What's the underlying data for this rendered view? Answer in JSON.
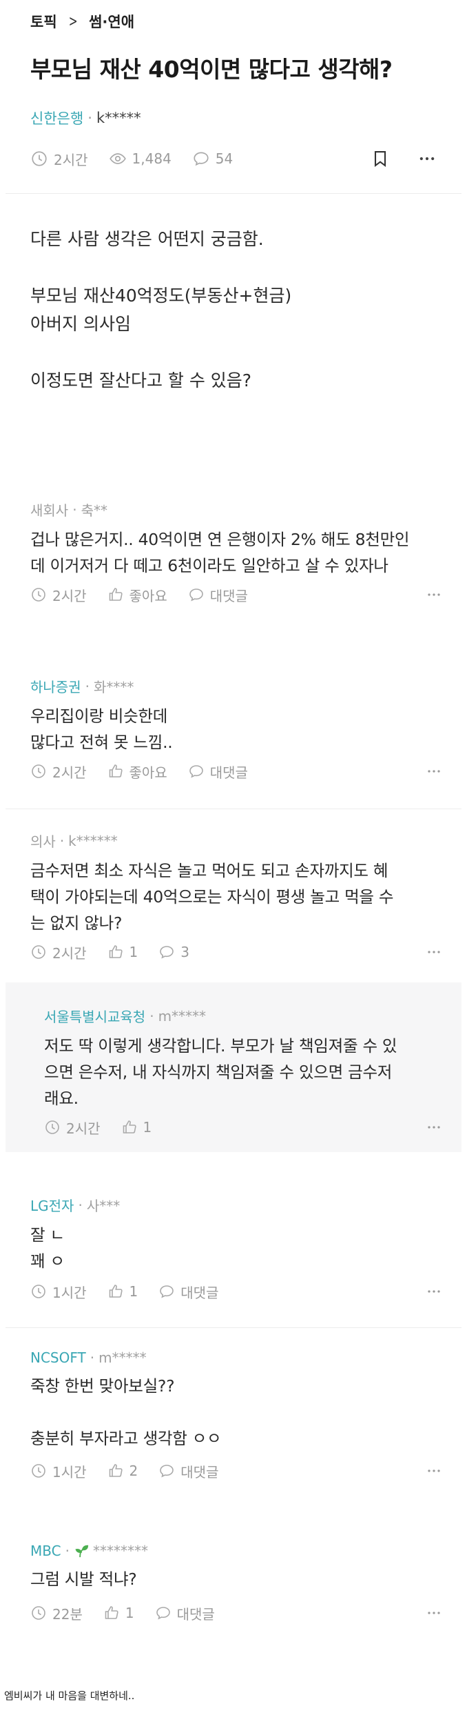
{
  "breadcrumb": {
    "topic": "토픽",
    "category": "썸·연애"
  },
  "post": {
    "title": "부모님 재산 40억이면 많다고 생각해?",
    "company": "신한은행",
    "author": "k*****",
    "time": "2시간",
    "views": "1,484",
    "comment_count": "54",
    "body": [
      "다른 사람 생각은 어떤지 궁금함.",
      "",
      "부모님 재산40억정도(부동산+현금)",
      "아버지 의사임",
      "",
      "이정도면 잘산다고 할 수 있음?"
    ]
  },
  "comments": [
    {
      "company": "새회사",
      "author": "축**",
      "text": [
        "겁나 많은거지.. 40억이면 연 은행이자 2% 해도 8천만인",
        "데 이거저거 다 떼고 6천이라도 일안하고 살 수 있자나"
      ],
      "time": "2시간",
      "like": "좋아요",
      "reply": "대댓글"
    },
    {
      "company": "하나증권",
      "author": "화****",
      "text": [
        "우리집이랑 비슷한데",
        "많다고 전혀 못 느낌.."
      ],
      "time": "2시간",
      "like": "좋아요",
      "reply": "대댓글"
    },
    {
      "company": "의사",
      "author": "k******",
      "text": [
        "금수저면 최소 자식은 놀고 먹어도 되고 손자까지도 혜",
        "택이 가야되는데 40억으로는 자식이 평생 놀고 먹을 수",
        "는 없지 않나?"
      ],
      "time": "2시간",
      "like": "1",
      "reply": "3"
    },
    {
      "company": "서울특별시교육청",
      "author": "m*****",
      "text": [
        "저도 딱 이렇게 생각합니다. 부모가 날 책임져줄 수 있",
        "으면 은수저, 내 자식까지 책임져줄 수 있으면 금수저",
        "래요."
      ],
      "time": "2시간",
      "like": "1"
    },
    {
      "company": "LG전자",
      "author": "사***",
      "text": [
        "잘 ㄴ",
        "꽤 ㅇ"
      ],
      "time": "1시간",
      "like": "1",
      "reply": "대댓글"
    },
    {
      "company": "NCSOFT",
      "author": "m*****",
      "text": [
        "죽창 한번 맞아보실??",
        "",
        "충분히 부자라고 생각함 ㅇㅇ"
      ],
      "time": "1시간",
      "like": "2",
      "reply": "대댓글"
    },
    {
      "company": "MBC",
      "author": "********",
      "text": [
        "그럼 시발 적냐?"
      ],
      "time": "22분",
      "like": "1",
      "reply": "대댓글"
    }
  ],
  "footer": "엠비씨가 내 마음을 대변하네..",
  "colors": {
    "accent": "#3aa7b4",
    "muted": "#9a9a9a",
    "reply_bg": "#f6f6f7",
    "sprout": "#4caf50"
  },
  "icons": [
    "chevron-right-icon",
    "clock-icon",
    "eye-icon",
    "speech-bubble-icon",
    "bookmark-icon",
    "more-dots-icon",
    "thumbs-up-icon",
    "sprout-icon"
  ]
}
